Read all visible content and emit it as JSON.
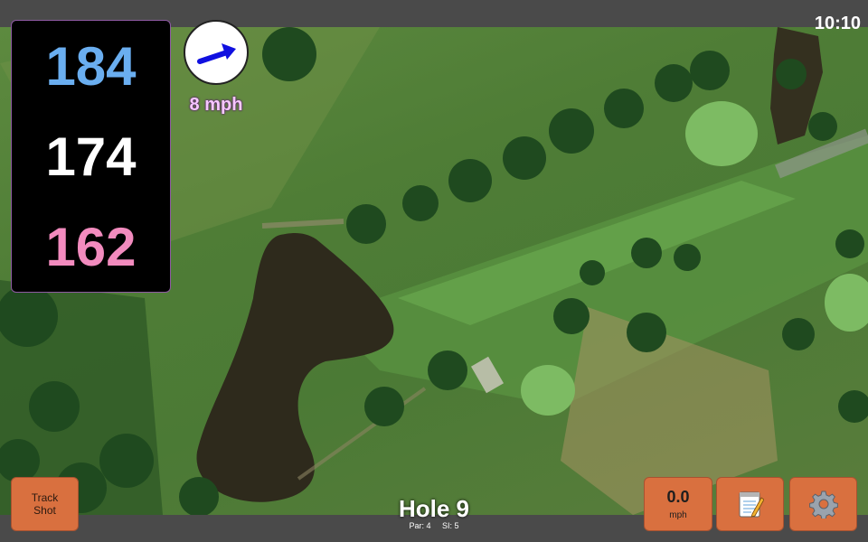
{
  "status": {
    "time": "10:10"
  },
  "distances": {
    "back": "184",
    "middle": "174",
    "front": "162"
  },
  "wind": {
    "speed_label": "8 mph",
    "direction_icon": "arrow-icon",
    "arrow_color": "#1010e0"
  },
  "hole": {
    "title": "Hole 9",
    "par_label": "Par: 4",
    "si_label": "SI: 5"
  },
  "buttons": {
    "track_shot_line1": "Track",
    "track_shot_line2": "Shot",
    "speed_value": "0.0",
    "speed_unit": "mph",
    "notes_icon": "notepad-icon",
    "settings_icon": "gear-icon"
  },
  "colors": {
    "button": "#d9703f",
    "back_distance": "#6aaef0",
    "middle_distance": "#ffffff",
    "front_distance": "#f28bbe"
  }
}
